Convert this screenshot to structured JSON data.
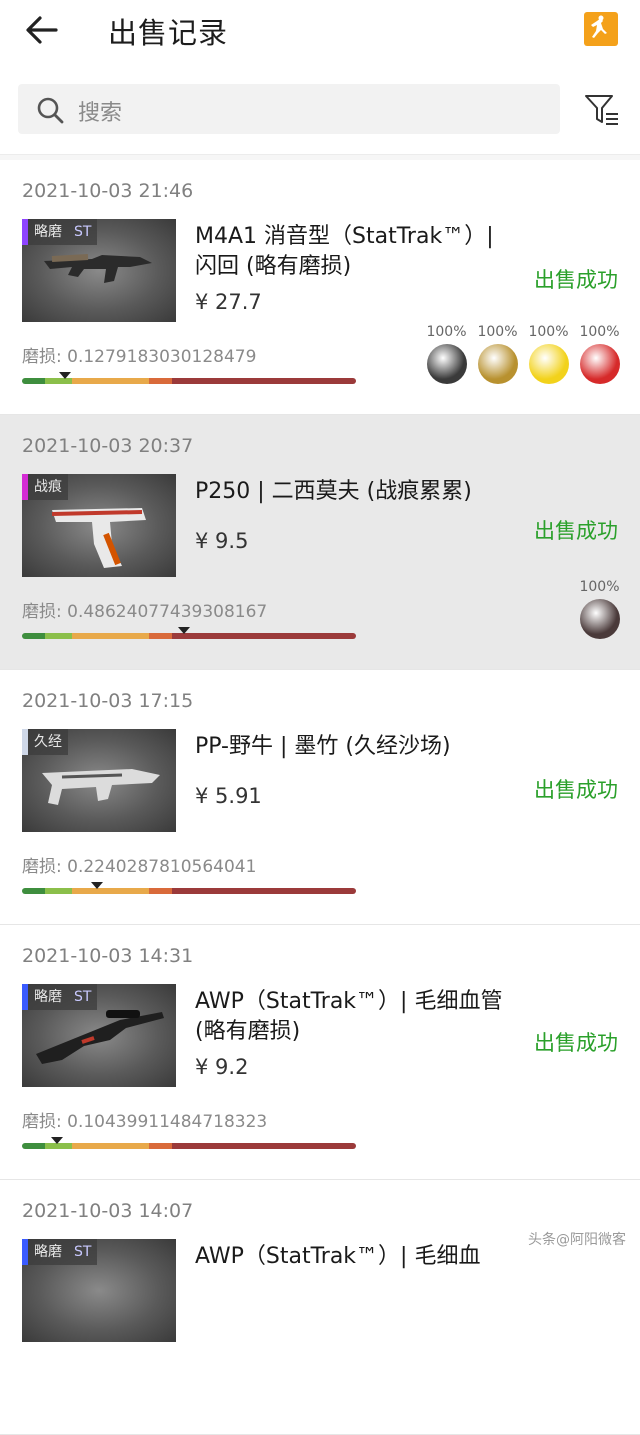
{
  "header": {
    "title": "出售记录"
  },
  "search": {
    "placeholder": "搜索"
  },
  "wear_label_prefix": "磨损: ",
  "status_color": "#2aa02a",
  "records": [
    {
      "time": "2021-10-03 21:46",
      "name": "M4A1 消音型（StatTrak™）| 闪回 (略有磨损)",
      "price": "¥ 27.7",
      "status": "出售成功",
      "tags": [
        "略磨",
        "ST"
      ],
      "tag_color": "#8e44ff",
      "wear": "0.1279183030128479",
      "stickers": [
        {
          "pct": "100%",
          "icon": "g2-sticker-icon"
        },
        {
          "pct": "100%",
          "icon": "geng-sticker-icon"
        },
        {
          "pct": "100%",
          "icon": "navi-sticker-icon"
        },
        {
          "pct": "100%",
          "icon": "tyloo-sticker-icon"
        }
      ]
    },
    {
      "time": "2021-10-03 20:37",
      "name": "P250 | 二西莫夫 (战痕累累)",
      "price": "¥ 9.5",
      "status": "出售成功",
      "tags": [
        "战痕"
      ],
      "tag_color": "#d42bd4",
      "wear": "0.48624077439308167",
      "stickers": [
        {
          "pct": "100%",
          "icon": "player-signature-sticker-icon"
        }
      ]
    },
    {
      "time": "2021-10-03 17:15",
      "name": "PP-野牛 | 墨竹 (久经沙场)",
      "price": "¥ 5.91",
      "status": "出售成功",
      "tags": [
        "久经"
      ],
      "tag_color": "#cfd8e8",
      "wear": "0.2240287810564041",
      "stickers": []
    },
    {
      "time": "2021-10-03 14:31",
      "name": "AWP（StatTrak™）| 毛细血管 (略有磨损)",
      "price": "¥ 9.2",
      "status": "出售成功",
      "tags": [
        "略磨",
        "ST"
      ],
      "tag_color": "#3a5bff",
      "wear": "0.10439911484718323",
      "stickers": []
    },
    {
      "time": "2021-10-03 14:07",
      "name": "AWP（StatTrak™）| 毛细血",
      "price": "",
      "status": "",
      "tags": [
        "略磨",
        "ST"
      ],
      "tag_color": "#3a5bff",
      "wear": "",
      "stickers": []
    }
  ],
  "watermark": "头条@阿阳微客"
}
